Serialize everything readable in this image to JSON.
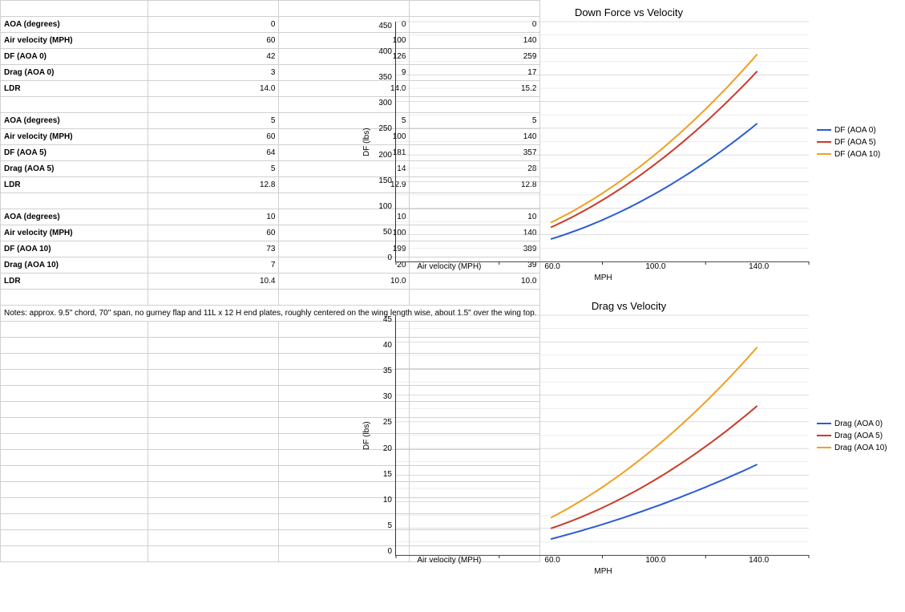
{
  "chart_data": [
    {
      "type": "line",
      "title": "Down Force vs Velocity",
      "xlabel": "MPH",
      "ylabel": "DF (lbs)",
      "x_axis_title_in_plot": "Air velocity (MPH)",
      "x": [
        60,
        100,
        140
      ],
      "x_ticks": [
        "Air velocity (MPH)",
        "60.0",
        "100.0",
        "140.0"
      ],
      "ylim": [
        0,
        450
      ],
      "ystep": 50,
      "series": [
        {
          "name": "DF (AOA 0)",
          "color": "#2a5cd6",
          "values": [
            42,
            126,
            259
          ]
        },
        {
          "name": "DF (AOA 5)",
          "color": "#cc3a2a",
          "values": [
            64,
            181,
            357
          ]
        },
        {
          "name": "DF (AOA 10)",
          "color": "#f0a020",
          "values": [
            73,
            199,
            389
          ]
        }
      ]
    },
    {
      "type": "line",
      "title": "Drag vs Velocity",
      "xlabel": "MPH",
      "ylabel": "DF (lbs)",
      "x_axis_title_in_plot": "Air velocity (MPH)",
      "x": [
        60,
        100,
        140
      ],
      "x_ticks": [
        "Air velocity (MPH)",
        "60.0",
        "100.0",
        "140.0"
      ],
      "ylim": [
        0,
        45
      ],
      "ystep": 5,
      "series": [
        {
          "name": "Drag (AOA 0)",
          "color": "#2a5cd6",
          "values": [
            3,
            9,
            17
          ]
        },
        {
          "name": "Drag (AOA 5)",
          "color": "#cc3a2a",
          "values": [
            5,
            14,
            28
          ]
        },
        {
          "name": "Drag (AOA 10)",
          "color": "#f0a020",
          "values": [
            7,
            20,
            39
          ]
        }
      ]
    }
  ],
  "tables": {
    "group0": {
      "rows": [
        {
          "label": "AOA (degrees)",
          "v": [
            "0",
            "0",
            "0"
          ]
        },
        {
          "label": "Air velocity (MPH)",
          "v": [
            "60",
            "100",
            "140"
          ]
        },
        {
          "label": "DF (AOA 0)",
          "v": [
            "42",
            "126",
            "259"
          ]
        },
        {
          "label": "Drag (AOA 0)",
          "v": [
            "3",
            "9",
            "17"
          ]
        },
        {
          "label": "LDR",
          "v": [
            "14.0",
            "14.0",
            "15.2"
          ]
        }
      ]
    },
    "group5": {
      "rows": [
        {
          "label": "AOA (degrees)",
          "v": [
            "5",
            "5",
            "5"
          ]
        },
        {
          "label": "Air velocity (MPH)",
          "v": [
            "60",
            "100",
            "140"
          ]
        },
        {
          "label": "DF (AOA 5)",
          "v": [
            "64",
            "181",
            "357"
          ]
        },
        {
          "label": "Drag (AOA 5)",
          "v": [
            "5",
            "14",
            "28"
          ]
        },
        {
          "label": "LDR",
          "v": [
            "12.8",
            "12.9",
            "12.8"
          ]
        }
      ]
    },
    "group10": {
      "rows": [
        {
          "label": "AOA (degrees)",
          "v": [
            "10",
            "10",
            "10"
          ]
        },
        {
          "label": "Air velocity (MPH)",
          "v": [
            "60",
            "100",
            "140"
          ]
        },
        {
          "label": "DF (AOA 10)",
          "v": [
            "73",
            "199",
            "389"
          ]
        },
        {
          "label": "Drag (AOA 10)",
          "v": [
            "7",
            "20",
            "39"
          ]
        },
        {
          "label": "LDR",
          "v": [
            "10.4",
            "10.0",
            "10.0"
          ]
        }
      ]
    }
  },
  "notes": "Notes: approx. 9.5\" chord, 70\" span, no gurney flap and 11L x 12 H end plates, roughly centered on the wing length wise, about 1.5\" over the wing top.",
  "blank_rows_after_notes": 15
}
